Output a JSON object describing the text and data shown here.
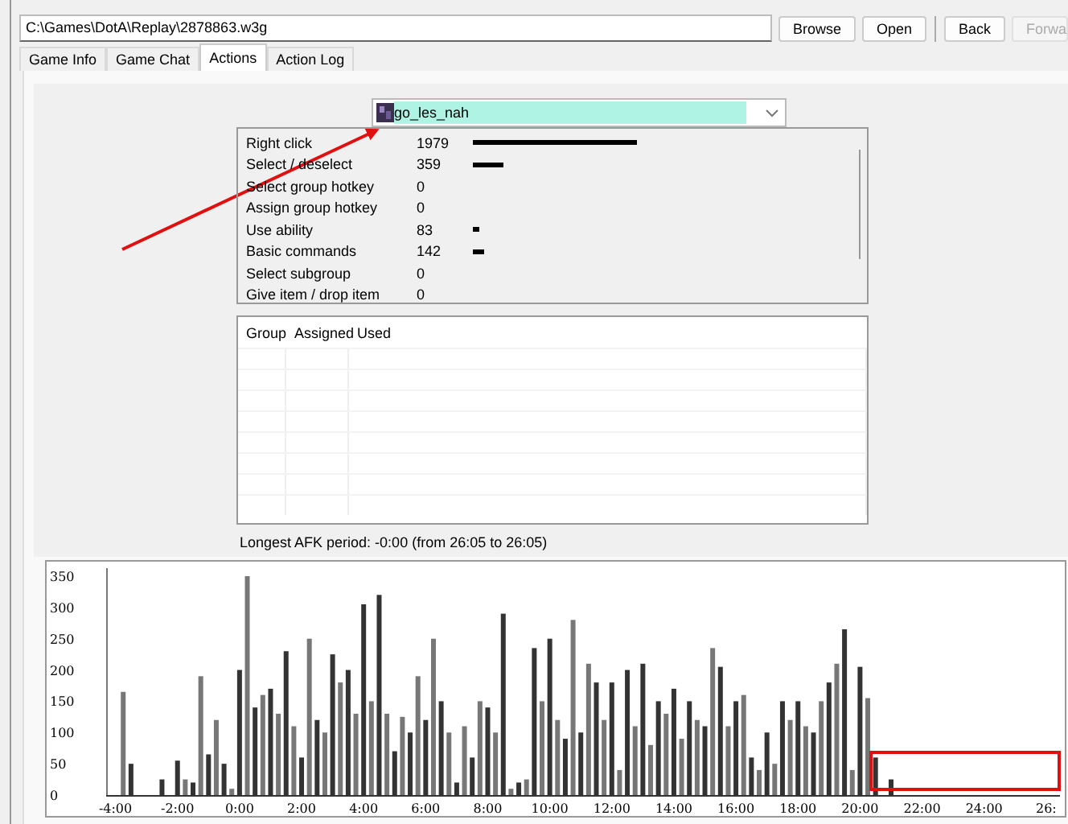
{
  "toolbar": {
    "path": "C:\\Games\\DotA\\Replay\\2878863.w3g",
    "buttons": [
      {
        "label": "Browse",
        "disabled": false
      },
      {
        "label": "Open",
        "disabled": false
      },
      {
        "label": "Back",
        "disabled": false
      },
      {
        "label": "Forwa",
        "disabled": true
      }
    ]
  },
  "tabs": [
    {
      "label": "Game Info",
      "selected": false
    },
    {
      "label": "Game Chat",
      "selected": false
    },
    {
      "label": "Actions",
      "selected": true
    },
    {
      "label": "Action Log",
      "selected": false
    }
  ],
  "player_select": {
    "value": "go_les_nah"
  },
  "actions": [
    {
      "name": "Right click",
      "count": "1979"
    },
    {
      "name": "Select / deselect",
      "count": "359"
    },
    {
      "name": "Select group hotkey",
      "count": "0"
    },
    {
      "name": "Assign group hotkey",
      "count": "0"
    },
    {
      "name": "Use ability",
      "count": "83"
    },
    {
      "name": "Basic commands",
      "count": "142"
    },
    {
      "name": "Select subgroup",
      "count": "0"
    },
    {
      "name": "Give item / drop item",
      "count": "0"
    }
  ],
  "groups_table": {
    "columns": [
      "Group",
      "Assigned",
      "Used"
    ]
  },
  "afk_text": "Longest AFK period: -0:00 (from 26:05 to 26:05)",
  "chart_data": {
    "type": "bar",
    "x": [
      -4,
      -3.75,
      -3.5,
      -3.25,
      -3,
      -2.75,
      -2.5,
      -2.25,
      -2,
      -1.75,
      -1.5,
      -1.25,
      -1,
      -0.75,
      -0.5,
      -0.25,
      0,
      0.25,
      0.5,
      0.75,
      1,
      1.25,
      1.5,
      1.75,
      2,
      2.25,
      2.5,
      2.75,
      3,
      3.25,
      3.5,
      3.75,
      4,
      4.25,
      4.5,
      4.75,
      5,
      5.25,
      5.5,
      5.75,
      6,
      6.25,
      6.5,
      6.75,
      7,
      7.25,
      7.5,
      7.75,
      8,
      8.25,
      8.5,
      8.75,
      9,
      9.25,
      9.5,
      9.75,
      10,
      10.25,
      10.5,
      10.75,
      11,
      11.25,
      11.5,
      11.75,
      12,
      12.25,
      12.5,
      12.75,
      13,
      13.25,
      13.5,
      13.75,
      14,
      14.25,
      14.5,
      14.75,
      15,
      15.25,
      15.5,
      15.75,
      16,
      16.25,
      16.5,
      16.75,
      17,
      17.25,
      17.5,
      17.75,
      18,
      18.25,
      18.5,
      18.75,
      19,
      19.25,
      19.5,
      19.75,
      20,
      20.25,
      20.5,
      20.75,
      21
    ],
    "values": [
      0,
      165,
      50,
      0,
      0,
      0,
      25,
      0,
      55,
      25,
      20,
      190,
      65,
      120,
      50,
      10,
      200,
      350,
      140,
      160,
      170,
      130,
      230,
      110,
      60,
      250,
      120,
      100,
      225,
      180,
      200,
      130,
      305,
      150,
      320,
      130,
      70,
      125,
      100,
      190,
      120,
      250,
      150,
      100,
      20,
      110,
      60,
      150,
      140,
      100,
      290,
      10,
      20,
      25,
      235,
      150,
      250,
      120,
      90,
      280,
      100,
      210,
      180,
      120,
      180,
      40,
      200,
      110,
      210,
      80,
      150,
      130,
      170,
      90,
      150,
      120,
      110,
      235,
      205,
      110,
      150,
      160,
      60,
      40,
      100,
      50,
      150,
      120,
      150,
      110,
      100,
      150,
      180,
      210,
      265,
      40,
      205,
      155,
      60,
      0,
      25
    ],
    "xlim": [
      -4.3,
      26.6
    ],
    "ylim": [
      0,
      350
    ],
    "xticks": [
      {
        "value": -4,
        "label": "-4:00"
      },
      {
        "value": -2,
        "label": "-2:00"
      },
      {
        "value": 0,
        "label": "0:00"
      },
      {
        "value": 2,
        "label": "2:00"
      },
      {
        "value": 4,
        "label": "4:00"
      },
      {
        "value": 6,
        "label": "6:00"
      },
      {
        "value": 8,
        "label": "8:00"
      },
      {
        "value": 10,
        "label": "10:00"
      },
      {
        "value": 12,
        "label": "12:00"
      },
      {
        "value": 14,
        "label": "14:00"
      },
      {
        "value": 16,
        "label": "16:00"
      },
      {
        "value": 18,
        "label": "18:00"
      },
      {
        "value": 20,
        "label": "20:00"
      },
      {
        "value": 22,
        "label": "22:00"
      },
      {
        "value": 24,
        "label": "24:00"
      },
      {
        "value": 26,
        "label": "26:"
      }
    ],
    "yticks": [
      0,
      50,
      100,
      150,
      200,
      250,
      300,
      350
    ]
  }
}
